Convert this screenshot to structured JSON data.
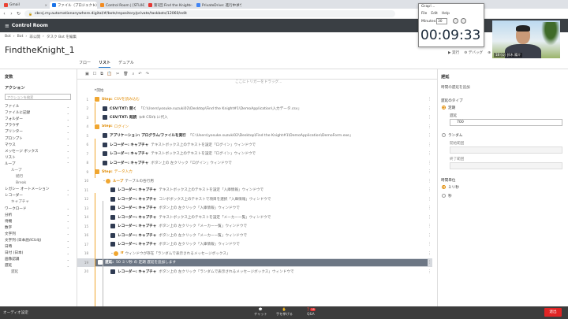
{
  "browser": {
    "tabs": [
      {
        "label": "Gmail",
        "color": "#ea4335"
      },
      {
        "label": "ファイル（プロジェクト）",
        "color": "#1a73e8"
      },
      {
        "label": "Control Room | [STL01] タスク...",
        "color": "#f28b20"
      },
      {
        "label": "第1回 Find the Knight - 信号フ...",
        "color": "#e53935"
      },
      {
        "label": "PrivateDrive: 進行中ダウンロード",
        "color": "#4285f4"
      }
    ],
    "url": "cbcsj.my.automationanywhere.digital/#/bots/repository/private/taskbots/12060/edit"
  },
  "app": {
    "title": "Control Room",
    "breadcrumbs": [
      "Bot",
      "›",
      "Bot",
      "›",
      "非公開",
      "›",
      "タスク Bot を編集"
    ],
    "bot_name": "FindtheKnight_1",
    "top_right": [
      "▶ 実行",
      "⚙ デバッグ",
      "⊕ その他",
      "閉じる"
    ],
    "view_tabs": [
      "フロー",
      "リスト",
      "デュアル"
    ],
    "active_tab": "リスト"
  },
  "left_panel": {
    "variables_label": "変数",
    "actions_label": "アクション",
    "search_placeholder": "アクションを検索",
    "items": [
      {
        "label": "ファイル",
        "type": "group"
      },
      {
        "label": "ファイルに記録",
        "type": "group"
      },
      {
        "label": "フォルダー",
        "type": "group"
      },
      {
        "label": "ブラウザ",
        "type": "group"
      },
      {
        "label": "プリンター",
        "type": "group"
      },
      {
        "label": "プロンプト",
        "type": "group"
      },
      {
        "label": "マウス",
        "type": "group"
      },
      {
        "label": "メッセージ ボックス",
        "type": "group"
      },
      {
        "label": "リスト",
        "type": "group"
      },
      {
        "label": "ループ",
        "type": "group-open"
      },
      {
        "label": "ループ",
        "type": "sub"
      },
      {
        "label": "続行",
        "type": "sub2"
      },
      {
        "label": "Break",
        "type": "sub2"
      },
      {
        "label": "レガシー オートメーション",
        "type": "group"
      },
      {
        "label": "レコーダー",
        "type": "group-open"
      },
      {
        "label": "キャプチャ",
        "type": "sub"
      },
      {
        "label": "ワークロード",
        "type": "group"
      },
      {
        "label": "分析",
        "type": "group"
      },
      {
        "label": "待機",
        "type": "group"
      },
      {
        "label": "数字",
        "type": "group"
      },
      {
        "label": "文字列",
        "type": "group"
      },
      {
        "label": "文字列 (日本語/ICU4J)",
        "type": "group"
      },
      {
        "label": "日時",
        "type": "group"
      },
      {
        "label": "日付 (日本)",
        "type": "group"
      },
      {
        "label": "画像認識",
        "type": "group"
      },
      {
        "label": "遅延",
        "type": "group"
      },
      {
        "label": "遅延",
        "type": "sub"
      }
    ]
  },
  "editor": {
    "trigger_hint": "ここにトリガーをドラッグ...",
    "rows": [
      {
        "ln": "",
        "indent": 1,
        "kind": "start",
        "text": "開始"
      },
      {
        "ln": "1",
        "indent": 1,
        "kind": "step",
        "label": "Step:",
        "text": "CSVを読み込む"
      },
      {
        "ln": "2",
        "indent": 2,
        "kind": "action",
        "bold": "CSV/TXT: 開く",
        "text": "「C:\\Users\\yosuke.suzuki02\\Desktop\\Find the Knight#1\\DemoApplication\\入力データ.csv」"
      },
      {
        "ln": "3",
        "indent": 2,
        "kind": "action",
        "bold": "CSV/TXT: 既読",
        "text": "$dt CSV$ に代入"
      },
      {
        "ln": "4",
        "indent": 1,
        "kind": "step",
        "label": "Step:",
        "text": "ログイン"
      },
      {
        "ln": "5",
        "indent": 2,
        "kind": "action",
        "bold": "アプリケーション: プログラム/ファイルを実行",
        "text": "「C:\\Users\\yosuke.suzuki02\\Desktop\\Find the Knight#1\\DemoApplication\\DemoForm.exe」"
      },
      {
        "ln": "6",
        "indent": 2,
        "kind": "action",
        "bold": "レコーダー: キャプチャ",
        "text": "テキストボックス上のテキストを設定「ログイン」ウィンドウで"
      },
      {
        "ln": "7",
        "indent": 2,
        "kind": "action",
        "bold": "レコーダー: キャプチャ",
        "text": "テキストボックス上のテキストを設定「ログイン」ウィンドウで"
      },
      {
        "ln": "8",
        "indent": 2,
        "kind": "action",
        "bold": "レコーダー: キャプチャ",
        "text": "ボタン上の 左クリック「ログイン」ウィンドウで"
      },
      {
        "ln": "9",
        "indent": 1,
        "kind": "step",
        "label": "Step:",
        "text": "データ入力"
      },
      {
        "ln": "10",
        "indent": 2,
        "kind": "loop",
        "label": "ループ",
        "text": "テーブルの各行用"
      },
      {
        "ln": "11",
        "indent": 3,
        "kind": "action",
        "bold": "レコーダー: キャプチャ",
        "text": "テキストボックス上のテキストを設定「入庫情報」ウィンドウで"
      },
      {
        "ln": "12",
        "indent": 3,
        "kind": "action",
        "bold": "レコーダー: キャプチャ",
        "text": "コンボボックス上のテキストで項目を選択「入庫情報」ウィンドウで"
      },
      {
        "ln": "13",
        "indent": 3,
        "kind": "action",
        "bold": "レコーダー: キャプチャ",
        "text": "ボタン上の 左クリック「入庫情報」ウィンドウで"
      },
      {
        "ln": "14",
        "indent": 3,
        "kind": "action",
        "bold": "レコーダー: キャプチャ",
        "text": "テキストボックス上のテキストを設定「メーカー一覧」ウィンドウで"
      },
      {
        "ln": "15",
        "indent": 3,
        "kind": "action",
        "bold": "レコーダー: キャプチャ",
        "text": "ボタン上の 左クリック「メーカー一覧」ウィンドウで"
      },
      {
        "ln": "16",
        "indent": 3,
        "kind": "action",
        "bold": "レコーダー: キャプチャ",
        "text": "ボタン上の 左クリック「メーカー一覧」ウィンドウで"
      },
      {
        "ln": "17",
        "indent": 3,
        "kind": "action",
        "bold": "レコーダー: キャプチャ",
        "text": "ボタン上の 左クリック「入庫情報」ウィンドウで"
      },
      {
        "ln": "18",
        "indent": 3,
        "kind": "if",
        "label": "If",
        "text": "ウィンドウが存在「ランダムで表示されるメッセージボックス」"
      },
      {
        "ln": "19",
        "indent": 3,
        "kind": "selected",
        "bold": "遅延:",
        "text": "50 ミリ秒 の 定期 遅延を追加します"
      },
      {
        "ln": "20",
        "indent": 3,
        "kind": "action",
        "bold": "レコーダー: キャプチャ",
        "text": "ボタン上の 左クリック「ランダムで表示されるメッセージボックス」ウィンドウで"
      }
    ]
  },
  "right_panel": {
    "title": "遅延",
    "desc": "時間の遅延を追加",
    "delay_type_label": "遅延のタイプ",
    "options": [
      "定期",
      "ランダム"
    ],
    "delay_label": "遅延",
    "delay_value": "700",
    "start_range_label": "開始範囲",
    "end_range_label": "終了範囲",
    "unit_label": "時間単位",
    "unit_options": [
      "ミリ秒",
      "秒"
    ]
  },
  "timer": {
    "title": "Grap!...",
    "menu": [
      "File",
      "Edit",
      "Help"
    ],
    "minutes_label": "Minutes:",
    "minutes_value": "30",
    "time": "00:09:33"
  },
  "video": {
    "name": "18 (公) 鈴木 陽介"
  },
  "taskbar": {
    "left": "オーディオ設定",
    "items": [
      "チャット",
      "手を挙げる",
      "Q&A"
    ],
    "qa_badge": "18",
    "leave": "退出"
  }
}
